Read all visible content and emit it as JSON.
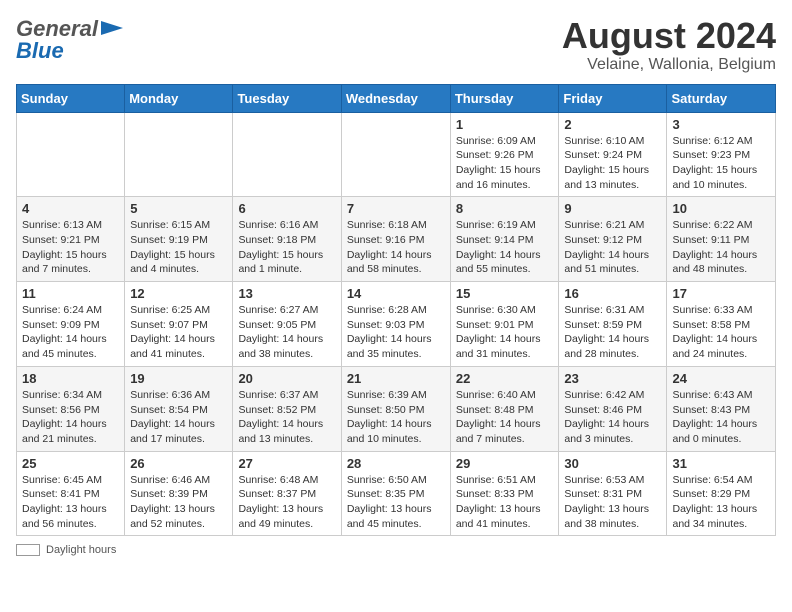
{
  "header": {
    "logo_line1": "General",
    "logo_line2": "Blue",
    "title": "August 2024",
    "subtitle": "Velaine, Wallonia, Belgium"
  },
  "calendar": {
    "days_of_week": [
      "Sunday",
      "Monday",
      "Tuesday",
      "Wednesday",
      "Thursday",
      "Friday",
      "Saturday"
    ],
    "weeks": [
      [
        {
          "day": "",
          "info": ""
        },
        {
          "day": "",
          "info": ""
        },
        {
          "day": "",
          "info": ""
        },
        {
          "day": "",
          "info": ""
        },
        {
          "day": "1",
          "info": "Sunrise: 6:09 AM\nSunset: 9:26 PM\nDaylight: 15 hours and 16 minutes."
        },
        {
          "day": "2",
          "info": "Sunrise: 6:10 AM\nSunset: 9:24 PM\nDaylight: 15 hours and 13 minutes."
        },
        {
          "day": "3",
          "info": "Sunrise: 6:12 AM\nSunset: 9:23 PM\nDaylight: 15 hours and 10 minutes."
        }
      ],
      [
        {
          "day": "4",
          "info": "Sunrise: 6:13 AM\nSunset: 9:21 PM\nDaylight: 15 hours and 7 minutes."
        },
        {
          "day": "5",
          "info": "Sunrise: 6:15 AM\nSunset: 9:19 PM\nDaylight: 15 hours and 4 minutes."
        },
        {
          "day": "6",
          "info": "Sunrise: 6:16 AM\nSunset: 9:18 PM\nDaylight: 15 hours and 1 minute."
        },
        {
          "day": "7",
          "info": "Sunrise: 6:18 AM\nSunset: 9:16 PM\nDaylight: 14 hours and 58 minutes."
        },
        {
          "day": "8",
          "info": "Sunrise: 6:19 AM\nSunset: 9:14 PM\nDaylight: 14 hours and 55 minutes."
        },
        {
          "day": "9",
          "info": "Sunrise: 6:21 AM\nSunset: 9:12 PM\nDaylight: 14 hours and 51 minutes."
        },
        {
          "day": "10",
          "info": "Sunrise: 6:22 AM\nSunset: 9:11 PM\nDaylight: 14 hours and 48 minutes."
        }
      ],
      [
        {
          "day": "11",
          "info": "Sunrise: 6:24 AM\nSunset: 9:09 PM\nDaylight: 14 hours and 45 minutes."
        },
        {
          "day": "12",
          "info": "Sunrise: 6:25 AM\nSunset: 9:07 PM\nDaylight: 14 hours and 41 minutes."
        },
        {
          "day": "13",
          "info": "Sunrise: 6:27 AM\nSunset: 9:05 PM\nDaylight: 14 hours and 38 minutes."
        },
        {
          "day": "14",
          "info": "Sunrise: 6:28 AM\nSunset: 9:03 PM\nDaylight: 14 hours and 35 minutes."
        },
        {
          "day": "15",
          "info": "Sunrise: 6:30 AM\nSunset: 9:01 PM\nDaylight: 14 hours and 31 minutes."
        },
        {
          "day": "16",
          "info": "Sunrise: 6:31 AM\nSunset: 8:59 PM\nDaylight: 14 hours and 28 minutes."
        },
        {
          "day": "17",
          "info": "Sunrise: 6:33 AM\nSunset: 8:58 PM\nDaylight: 14 hours and 24 minutes."
        }
      ],
      [
        {
          "day": "18",
          "info": "Sunrise: 6:34 AM\nSunset: 8:56 PM\nDaylight: 14 hours and 21 minutes."
        },
        {
          "day": "19",
          "info": "Sunrise: 6:36 AM\nSunset: 8:54 PM\nDaylight: 14 hours and 17 minutes."
        },
        {
          "day": "20",
          "info": "Sunrise: 6:37 AM\nSunset: 8:52 PM\nDaylight: 14 hours and 13 minutes."
        },
        {
          "day": "21",
          "info": "Sunrise: 6:39 AM\nSunset: 8:50 PM\nDaylight: 14 hours and 10 minutes."
        },
        {
          "day": "22",
          "info": "Sunrise: 6:40 AM\nSunset: 8:48 PM\nDaylight: 14 hours and 7 minutes."
        },
        {
          "day": "23",
          "info": "Sunrise: 6:42 AM\nSunset: 8:46 PM\nDaylight: 14 hours and 3 minutes."
        },
        {
          "day": "24",
          "info": "Sunrise: 6:43 AM\nSunset: 8:43 PM\nDaylight: 14 hours and 0 minutes."
        }
      ],
      [
        {
          "day": "25",
          "info": "Sunrise: 6:45 AM\nSunset: 8:41 PM\nDaylight: 13 hours and 56 minutes."
        },
        {
          "day": "26",
          "info": "Sunrise: 6:46 AM\nSunset: 8:39 PM\nDaylight: 13 hours and 52 minutes."
        },
        {
          "day": "27",
          "info": "Sunrise: 6:48 AM\nSunset: 8:37 PM\nDaylight: 13 hours and 49 minutes."
        },
        {
          "day": "28",
          "info": "Sunrise: 6:50 AM\nSunset: 8:35 PM\nDaylight: 13 hours and 45 minutes."
        },
        {
          "day": "29",
          "info": "Sunrise: 6:51 AM\nSunset: 8:33 PM\nDaylight: 13 hours and 41 minutes."
        },
        {
          "day": "30",
          "info": "Sunrise: 6:53 AM\nSunset: 8:31 PM\nDaylight: 13 hours and 38 minutes."
        },
        {
          "day": "31",
          "info": "Sunrise: 6:54 AM\nSunset: 8:29 PM\nDaylight: 13 hours and 34 minutes."
        }
      ]
    ]
  },
  "footer": {
    "daylight_label": "Daylight hours"
  }
}
